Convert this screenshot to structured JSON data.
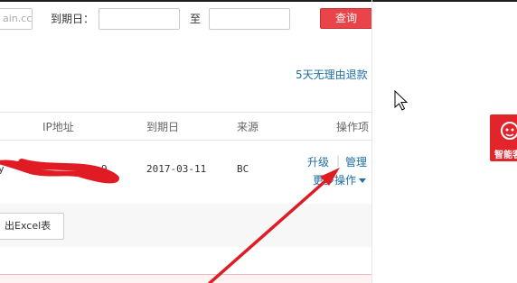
{
  "filter": {
    "domain_placeholder": "ain.cc",
    "expire_label": "到期日：",
    "to_label": "至",
    "search_label": "查询"
  },
  "notice": {
    "refund_link": "5天无理由退款"
  },
  "table": {
    "headers": {
      "ip": "IP地址",
      "expire": "到期日",
      "source": "来源",
      "actions": "操作项"
    },
    "rows": [
      {
        "partial_name": "y",
        "ip_tail": "9",
        "expire": "2017-03-11",
        "source": "BC",
        "upgrade": "升级",
        "separator": "|",
        "manage": "管理",
        "more_actions": "更多操作"
      }
    ]
  },
  "export": {
    "label": "出Excel表"
  },
  "service_widget": {
    "label": "智能客"
  },
  "colors": {
    "accent_red": "#e8444a",
    "link_blue": "#1d6fa5",
    "annotation_red": "#e01b24"
  },
  "icons": {
    "more_actions": "caret-down-icon",
    "cursor": "mouse-pointer-icon",
    "service": "headset-icon"
  }
}
